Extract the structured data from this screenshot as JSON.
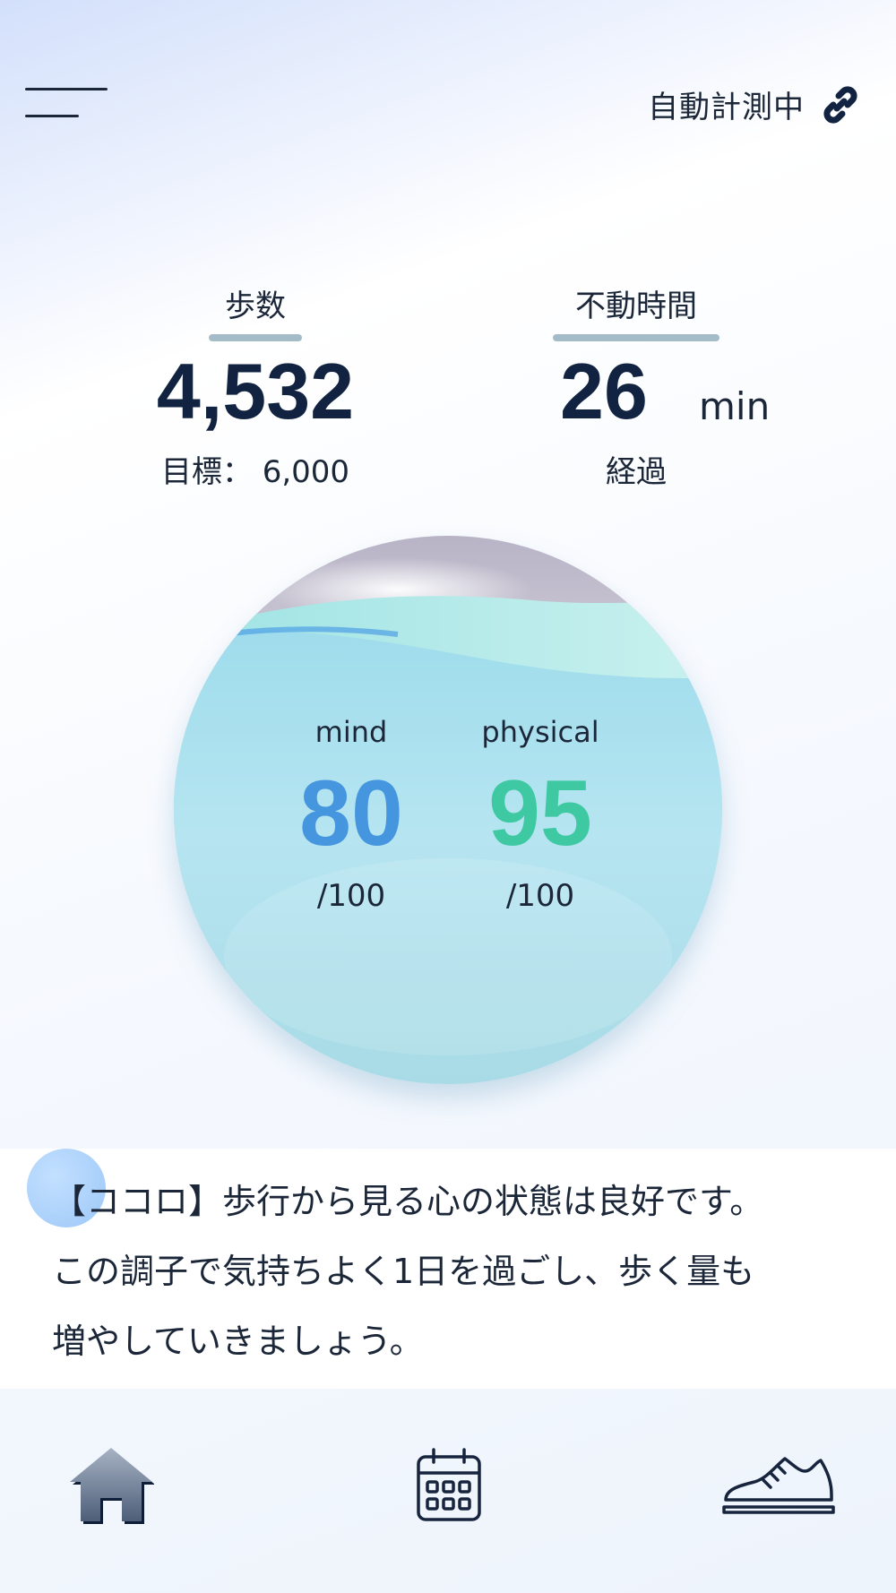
{
  "header": {
    "menu_icon": "hamburger-menu-icon",
    "status_label": "自動計測中",
    "status_icon": "link-icon"
  },
  "stats": {
    "steps": {
      "label": "歩数",
      "value": "4,532",
      "goal_text": "目標： 6,000"
    },
    "inactive_time": {
      "label": "不動時間",
      "value": "26",
      "unit": "min",
      "sub": "経過"
    }
  },
  "scores": {
    "mind": {
      "label": "mind",
      "value": "80",
      "max": "/100",
      "color": "#4596de"
    },
    "physical": {
      "label": "physical",
      "value": "95",
      "max": "/100",
      "color": "#3ec9a2"
    }
  },
  "message": {
    "text": "【ココロ】歩行から見る心の状態は良好です。\nこの調子で気持ちよく1日を過ごし、歩く量も\n増やしていきましょう。"
  },
  "bottom_nav": {
    "items": [
      {
        "icon": "home-icon",
        "active": true
      },
      {
        "icon": "calendar-icon",
        "active": false
      },
      {
        "icon": "sneaker-icon",
        "active": false
      }
    ]
  },
  "colors": {
    "primary_text": "#112340",
    "mind_accent": "#4596de",
    "physical_accent": "#3ec9a2",
    "water": "#a9dfef"
  }
}
